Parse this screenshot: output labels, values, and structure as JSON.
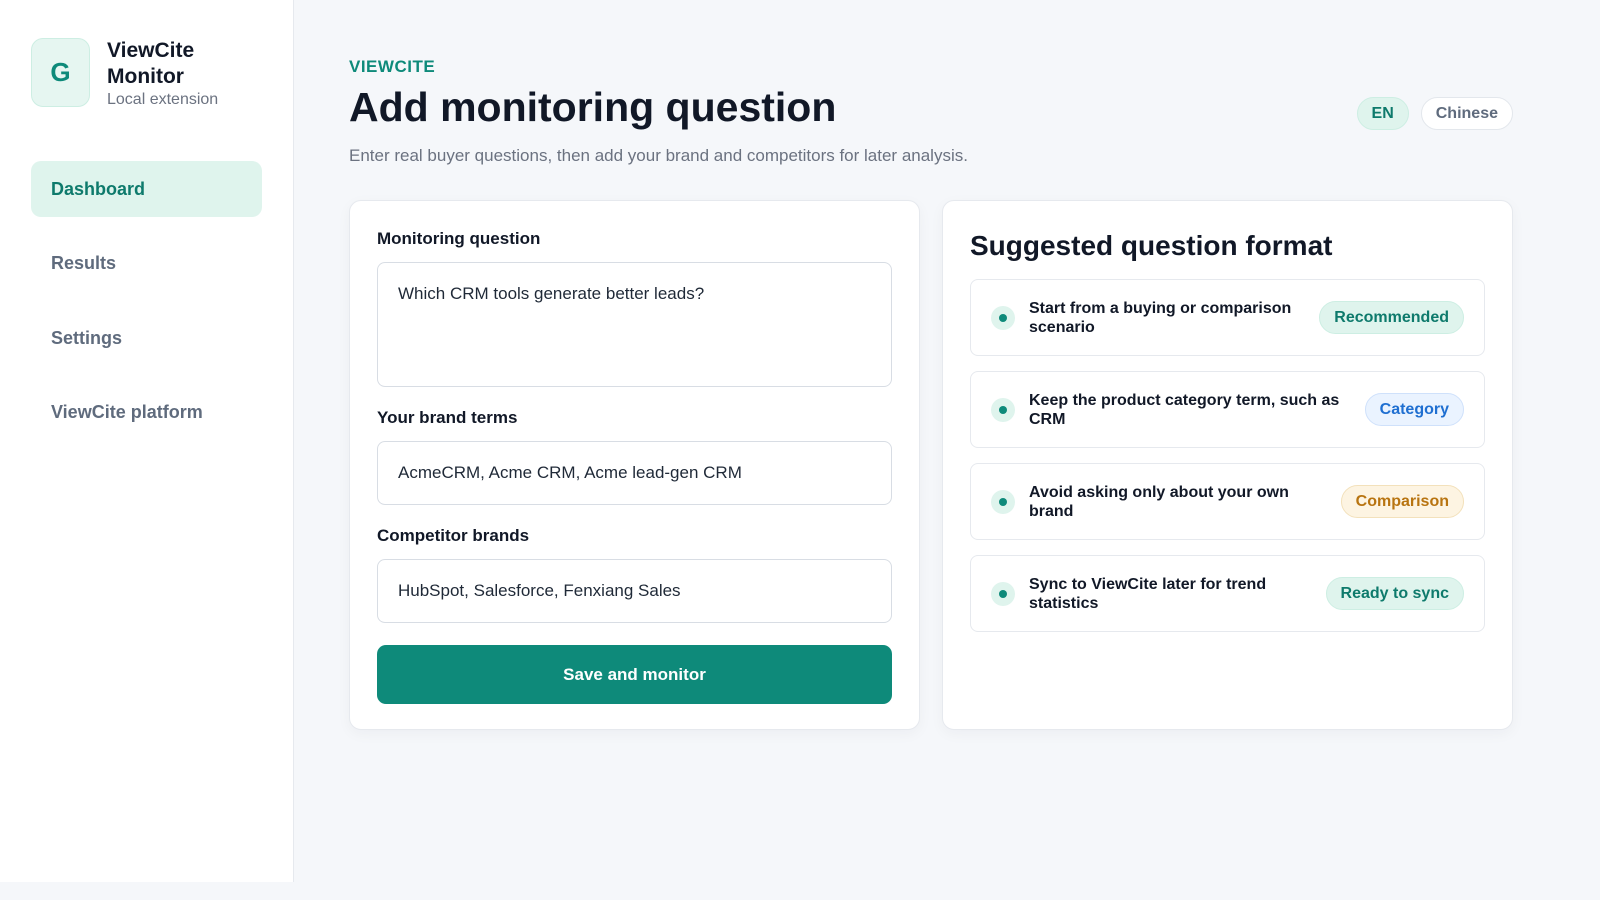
{
  "app": {
    "logo_letter": "G",
    "name": "ViewCite Monitor",
    "subtitle": "Local extension"
  },
  "sidebar": {
    "items": [
      {
        "label": "Dashboard",
        "active": true
      },
      {
        "label": "Results",
        "active": false
      },
      {
        "label": "Settings",
        "active": false
      },
      {
        "label": "ViewCite platform",
        "active": false
      }
    ]
  },
  "header": {
    "eyebrow": "VIEWCITE",
    "title": "Add monitoring question",
    "subtitle": "Enter real buyer questions, then add your brand and competitors for later analysis.",
    "languages": [
      {
        "label": "EN",
        "active": true
      },
      {
        "label": "Chinese",
        "active": false
      }
    ]
  },
  "form": {
    "question_label": "Monitoring question",
    "question_value": "Which CRM tools generate better leads?",
    "brand_label": "Your brand terms",
    "brand_value": "AcmeCRM, Acme CRM, Acme lead-gen CRM",
    "competitor_label": "Competitor brands",
    "competitor_value": "HubSpot, Salesforce, Fenxiang Sales",
    "save_label": "Save and monitor"
  },
  "suggestions": {
    "title": "Suggested question format",
    "items": [
      {
        "text": "Start from a buying or comparison scenario",
        "badge": "Recommended",
        "badge_color": "#0e7a6c"
      },
      {
        "text": "Keep the product category term, such as CRM",
        "badge": "Category",
        "badge_color": "#1f6fd1"
      },
      {
        "text": "Avoid asking only about your own brand",
        "badge": "Comparison",
        "badge_color": "#b87410"
      },
      {
        "text": "Sync to ViewCite later for trend statistics",
        "badge": "Ready to sync",
        "badge_color": "#0e7a6c"
      }
    ]
  },
  "colors": {
    "accent": "#0e8a7a",
    "accent_soft": "#dff4ed",
    "background": "#f5f7fa"
  }
}
